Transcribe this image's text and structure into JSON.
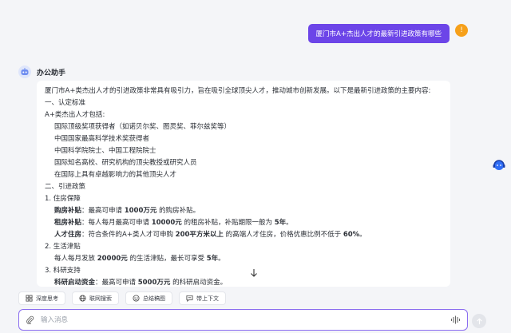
{
  "user_message": "厦门市A+杰出人才的最新引进政策有哪些",
  "user_avatar_glyph": "!",
  "bot": {
    "name": "办公助手"
  },
  "answer": {
    "intro": "厦门市A+类杰出人才的引进政策非常具有吸引力，旨在吸引全球顶尖人才，推动城市创新发展。以下是最新引进政策的主要内容:",
    "section1": "一、认定标准",
    "include_label": "A+类杰出人才包括:",
    "criteria": [
      "国际顶级奖项获得者（如诺贝尔奖、图灵奖、菲尔兹奖等）",
      "中国国家最高科学技术奖获得者",
      "中国科学院院士、中国工程院院士",
      "国际知名高校、研究机构的顶尖教授或研究人员",
      "在国际上具有卓越影响力的其他顶尖人才"
    ],
    "section2": "二、引进政策",
    "housing": {
      "title": "1. 住房保障",
      "items": [
        {
          "label": "购房补贴",
          "pre": "：最高可申请 ",
          "bold": "1000万元",
          "post": " 的购房补贴。",
          "pre2": "",
          "bold2": "",
          "post2": ""
        },
        {
          "label": "租房补贴",
          "pre": "：每人每月最高可申请 ",
          "bold": "10000元",
          "post": " 的租房补贴，补贴期限一般为 ",
          "pre2": "",
          "bold2": "5年",
          "post2": "。"
        },
        {
          "label": "人才住房",
          "pre": "：符合条件的A+类人才可申购 ",
          "bold": "200平方米以上",
          "post": " 的高端人才住房，价格优惠比例不低于 ",
          "pre2": "",
          "bold2": "60%",
          "post2": "。"
        }
      ]
    },
    "living": {
      "title": "2. 生活津贴",
      "pre": "每人每月发放 ",
      "bold": "20000元",
      "mid": " 的生活津贴，最长可享受 ",
      "bold2": "5年",
      "post": "。"
    },
    "research": {
      "title": "3. 科研支持",
      "label": "科研启动资金",
      "pre": "：最高可申请 ",
      "bold": "5000万元",
      "post": " 的科研启动资金。"
    }
  },
  "tools": [
    {
      "icon": "deep-think-icon",
      "label": "深度思考"
    },
    {
      "icon": "globe-icon",
      "label": "联网搜索"
    },
    {
      "icon": "summary-icon",
      "label": "总结稿图"
    },
    {
      "icon": "context-icon",
      "label": "带上下文"
    }
  ],
  "input": {
    "placeholder": "输入消息"
  },
  "colors": {
    "accent": "#6c45e8",
    "avatar_orange": "#f6a01a",
    "input_border": "#8b6df0"
  }
}
